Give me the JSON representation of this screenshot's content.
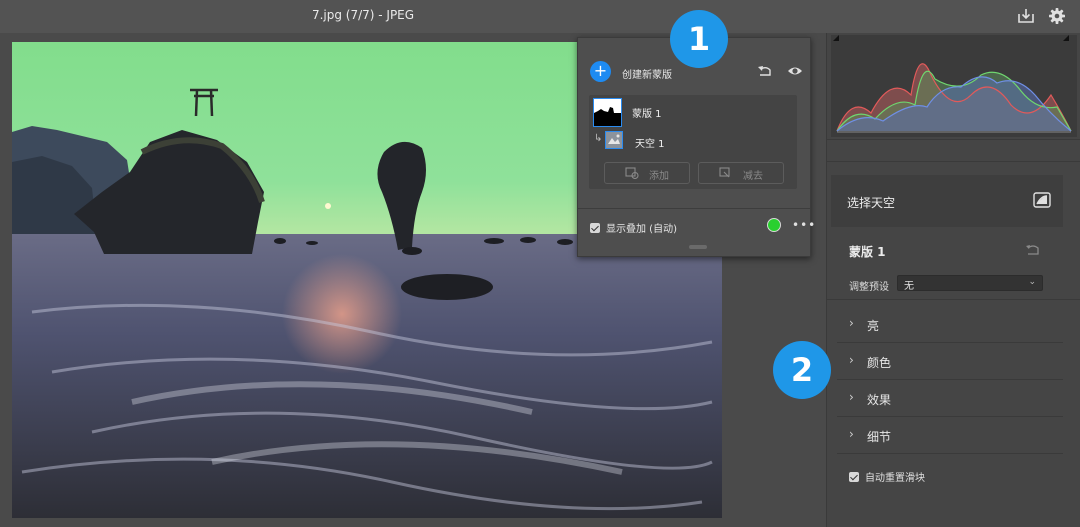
{
  "window": {
    "title": "7.jpg (7/7) -  JPEG"
  },
  "toolbar": {
    "export_icon": "export-icon",
    "settings_icon": "gear-icon"
  },
  "masks_panel": {
    "create_label": "创建新蒙版",
    "mask_item": {
      "label": "蒙版 1"
    },
    "sub_item": {
      "label": "天空 1"
    },
    "add_label": "添加",
    "subtract_label": "减去",
    "overlay_label": "显示叠加 (自动)",
    "overlay_color": "#29d02f",
    "accent_color": "#1e8bf2"
  },
  "right_panel": {
    "select_sky_label": "选择天空",
    "mask_name": "蒙版 1",
    "preset_label": "调整预设",
    "preset_value": "无",
    "sections": [
      {
        "label": "亮"
      },
      {
        "label": "颜色"
      },
      {
        "label": "效果"
      },
      {
        "label": "细节"
      }
    ],
    "auto_reset_label": "自动重置滑块"
  },
  "callouts": {
    "one": "1",
    "two": "2"
  }
}
